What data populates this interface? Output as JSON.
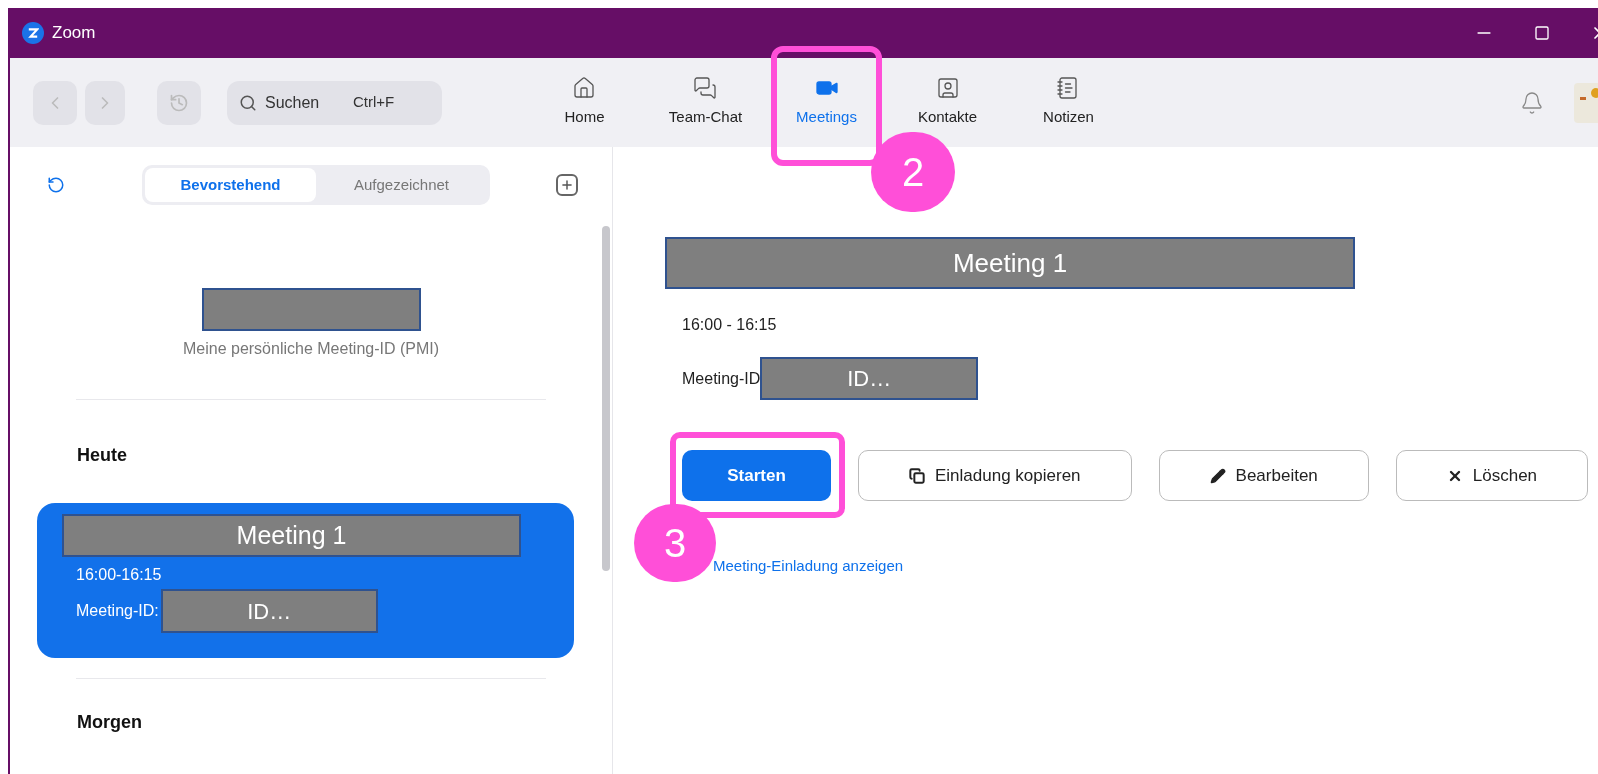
{
  "window": {
    "title": "Zoom"
  },
  "toolbar": {
    "search": {
      "placeholder": "Suchen",
      "shortcut": "Ctrl+F"
    },
    "tabs": [
      {
        "label": "Home",
        "kind": "home",
        "selected": false
      },
      {
        "label": "Team-Chat",
        "kind": "chat",
        "selected": false
      },
      {
        "label": "Meetings",
        "kind": "video",
        "selected": true,
        "annotation": "2"
      },
      {
        "label": "Kontakte",
        "kind": "contact",
        "selected": false
      },
      {
        "label": "Notizen",
        "kind": "notes",
        "selected": false
      }
    ]
  },
  "meetings_panel": {
    "segments": [
      {
        "label": "Bevorstehend",
        "selected": true
      },
      {
        "label": "Aufgezeichnet",
        "selected": false
      }
    ],
    "pmi_label": "Meine persönliche Meeting-ID (PMI)",
    "sections": [
      {
        "title": "Heute",
        "meetings": [
          {
            "title": "Meeting 1",
            "time": "16:00-16:15",
            "id_label": "Meeting-ID:",
            "id": "ID…",
            "selected": true
          }
        ]
      },
      {
        "title": "Morgen"
      }
    ]
  },
  "detail": {
    "title": "Meeting 1",
    "time": "16:00 - 16:15",
    "id_label": "Meeting-ID",
    "id": "ID…",
    "buttons": [
      {
        "label": "Starten",
        "kind": "primary",
        "annotation": "3"
      },
      {
        "label": "Einladung kopieren",
        "kind": "copy"
      },
      {
        "label": "Bearbeiten",
        "kind": "edit"
      },
      {
        "label": "Löschen",
        "kind": "delete"
      }
    ],
    "link": "Meeting-Einladung anzeigen"
  }
}
